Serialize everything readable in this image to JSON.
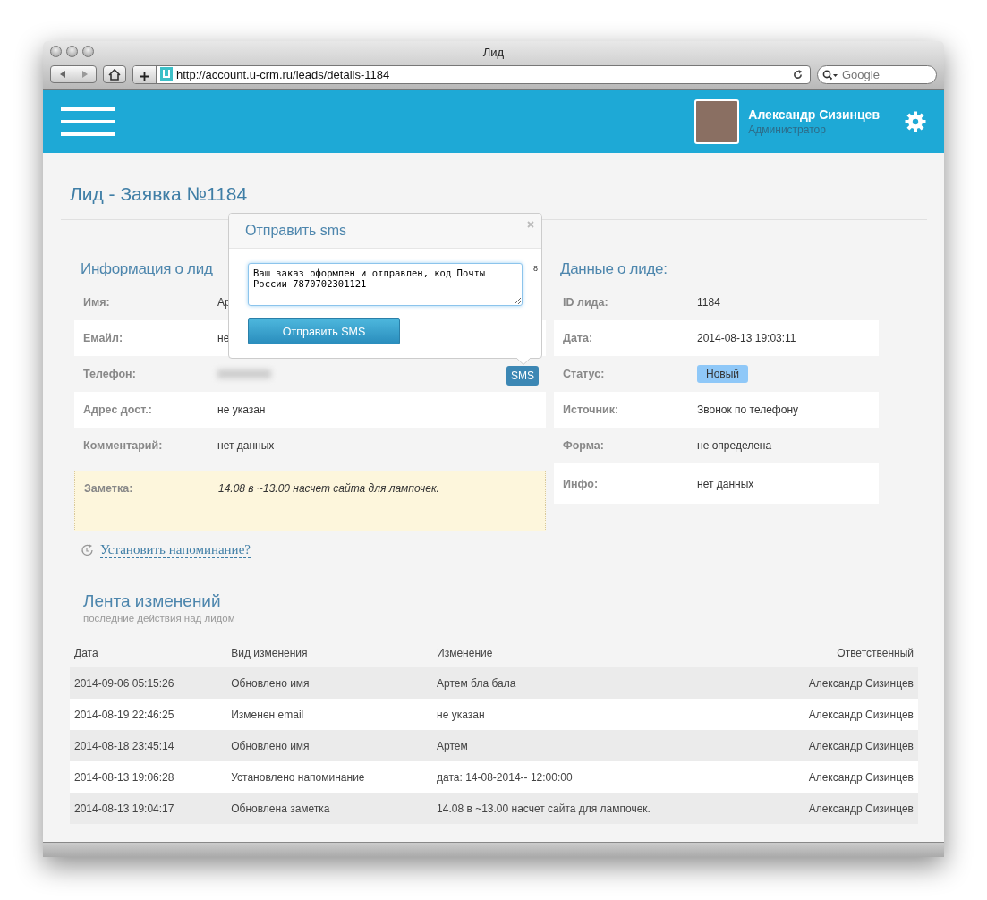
{
  "window": {
    "title": "Лид"
  },
  "browser": {
    "url": "http://account.u-crm.ru/leads/details-1184",
    "search_placeholder": "Google"
  },
  "header": {
    "user_name": "Александр Сизинцев",
    "user_role": "Администратор"
  },
  "page_title": "Лид - Заявка №1184",
  "lead_info": {
    "title": "Информация о лид",
    "rows": [
      {
        "kind": "text",
        "label": "Имя:",
        "value": "Ар"
      },
      {
        "kind": "text",
        "label": "Емайл:",
        "value": "не"
      },
      {
        "kind": "blurred",
        "label": "Телефон:",
        "action": "SMS"
      },
      {
        "kind": "text",
        "label": "Адрес дост.:",
        "value": "не указан"
      },
      {
        "kind": "text",
        "label": "Комментарий:",
        "value": "нет данных"
      },
      {
        "kind": "note",
        "label": "Заметка:",
        "value": "14.08 в ~13.00 насчет сайта для лампочек."
      }
    ]
  },
  "lead_data": {
    "title": "Данные о лиде:",
    "rows": [
      {
        "kind": "text",
        "label": "ID лида:",
        "value": "1184"
      },
      {
        "kind": "text",
        "label": "Дата:",
        "value": "2014-08-13 19:03:11"
      },
      {
        "kind": "badge",
        "label": "Статус:",
        "value": "Новый"
      },
      {
        "kind": "text",
        "label": "Источник:",
        "value": "Звонок по телефону"
      },
      {
        "kind": "text",
        "label": "Форма:",
        "value": "не определена"
      },
      {
        "kind": "text",
        "label": "Инфо:",
        "value": "нет данных"
      }
    ]
  },
  "reminder_link": "Установить напоминание?",
  "sms_popup": {
    "title": "Отправить sms",
    "message": "Ваш заказ оформлен и отправлен, код Почты России 7870702301121",
    "counter": "8",
    "send_button": "Отправить SMS"
  },
  "feed": {
    "title": "Лента изменений",
    "subtitle": "последние действия над лидом",
    "columns": [
      "Дата",
      "Вид изменения",
      "Изменение",
      "Ответственный"
    ],
    "rows": [
      [
        "2014-09-06 05:15:26",
        "Обновлено имя",
        "Артем бла бала",
        "Александр Сизинцев"
      ],
      [
        "2014-08-19 22:46:25",
        "Изменен email",
        "не указан",
        "Александр Сизинцев"
      ],
      [
        "2014-08-18 23:45:14",
        "Обновлено имя",
        "Артем",
        "Александр Сизинцев"
      ],
      [
        "2014-08-13 19:06:28",
        "Установлено напоминание",
        "дата: 14-08-2014-- 12:00:00",
        "Александр Сизинцев"
      ],
      [
        "2014-08-13 19:04:17",
        "Обновлена заметка",
        "14.08 в ~13.00 насчет сайта для лампочек.",
        "Александр Сизинцев"
      ]
    ]
  }
}
